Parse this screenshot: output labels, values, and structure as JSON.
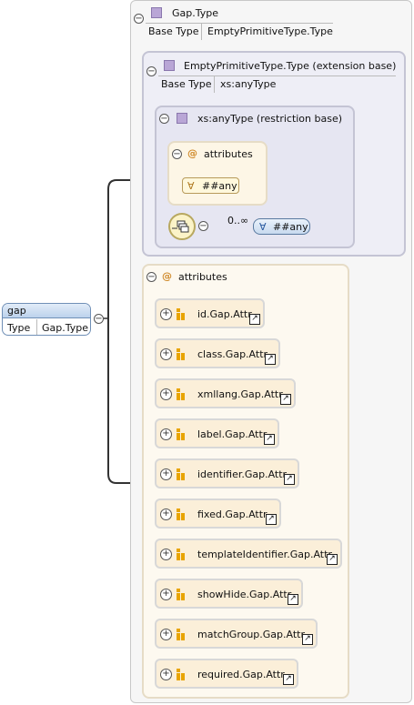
{
  "element": {
    "name": "gap",
    "type_key": "Type",
    "type_value": "Gap.Type"
  },
  "complex_type": {
    "name": "Gap.Type",
    "base_key": "Base Type",
    "base_value": "EmptyPrimitiveType.Type"
  },
  "extension": {
    "name": "EmptyPrimitiveType.Type (extension base)",
    "base_key": "Base Type",
    "base_value": "xs:anyType"
  },
  "restriction": {
    "name": "xs:anyType (restriction base)",
    "attributes_label": "attributes",
    "any_attribute": "##any",
    "occurrence": "0..∞",
    "any_element": "##any"
  },
  "attributes": {
    "label": "attributes",
    "items": [
      "id.Gap.Attr",
      "class.Gap.Attr",
      "xmllang.Gap.Attr",
      "label.Gap.Attr",
      "identifier.Gap.Attr",
      "fixed.Gap.Attr",
      "templateIdentifier.Gap.Attr",
      "showHide.Gap.Attr",
      "matchGroup.Gap.Attr",
      "required.Gap.Attr"
    ]
  },
  "icons": {
    "collapse": "minus-circle-icon",
    "expand": "plus-circle-icon",
    "complex_type": "type-square-icon",
    "attribute_group": "attribute-group-icon",
    "reference": "reference-arrow-icon",
    "sequence": "sequence-compositor-icon",
    "wildcard": "wildcard-icon"
  },
  "colors": {
    "attribute_fill": "#fbefd9",
    "type_square": "#b9a6d6",
    "element_header": "#bcd2ec",
    "at_sign": "#d08a2a"
  }
}
